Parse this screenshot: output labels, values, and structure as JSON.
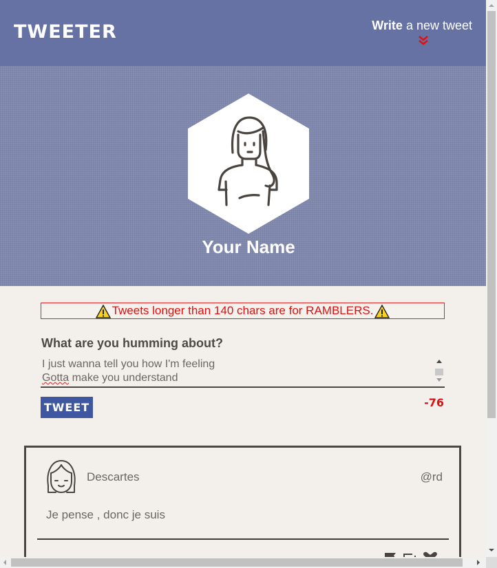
{
  "header": {
    "logo": "TWEETER",
    "write_bold": "Write",
    "write_rest": " a new tweet"
  },
  "profile": {
    "name": "Your Name"
  },
  "composer": {
    "warning": "Tweets longer than 140 chars are for RAMBLERS.",
    "label": "What are you humming about?",
    "lines": [
      "I just wanna tell you how I'm feeling",
      "Gotta",
      " make you understand"
    ],
    "button": "TWEET",
    "counter": "-76"
  },
  "tweet": {
    "author": "Descartes",
    "handle": "@rd",
    "text": "Je pense , donc je suis"
  },
  "colors": {
    "header_bg": "#6572a3",
    "banner_bg": "#8088ae",
    "accent_blue": "#3e57a0",
    "warning_red": "#e01010"
  },
  "icons": [
    "chevron-double-down-icon",
    "warning-icon",
    "avatar-woman-icon",
    "avatar-girl-icon",
    "flag-icon",
    "retweet-icon",
    "heart-icon"
  ]
}
